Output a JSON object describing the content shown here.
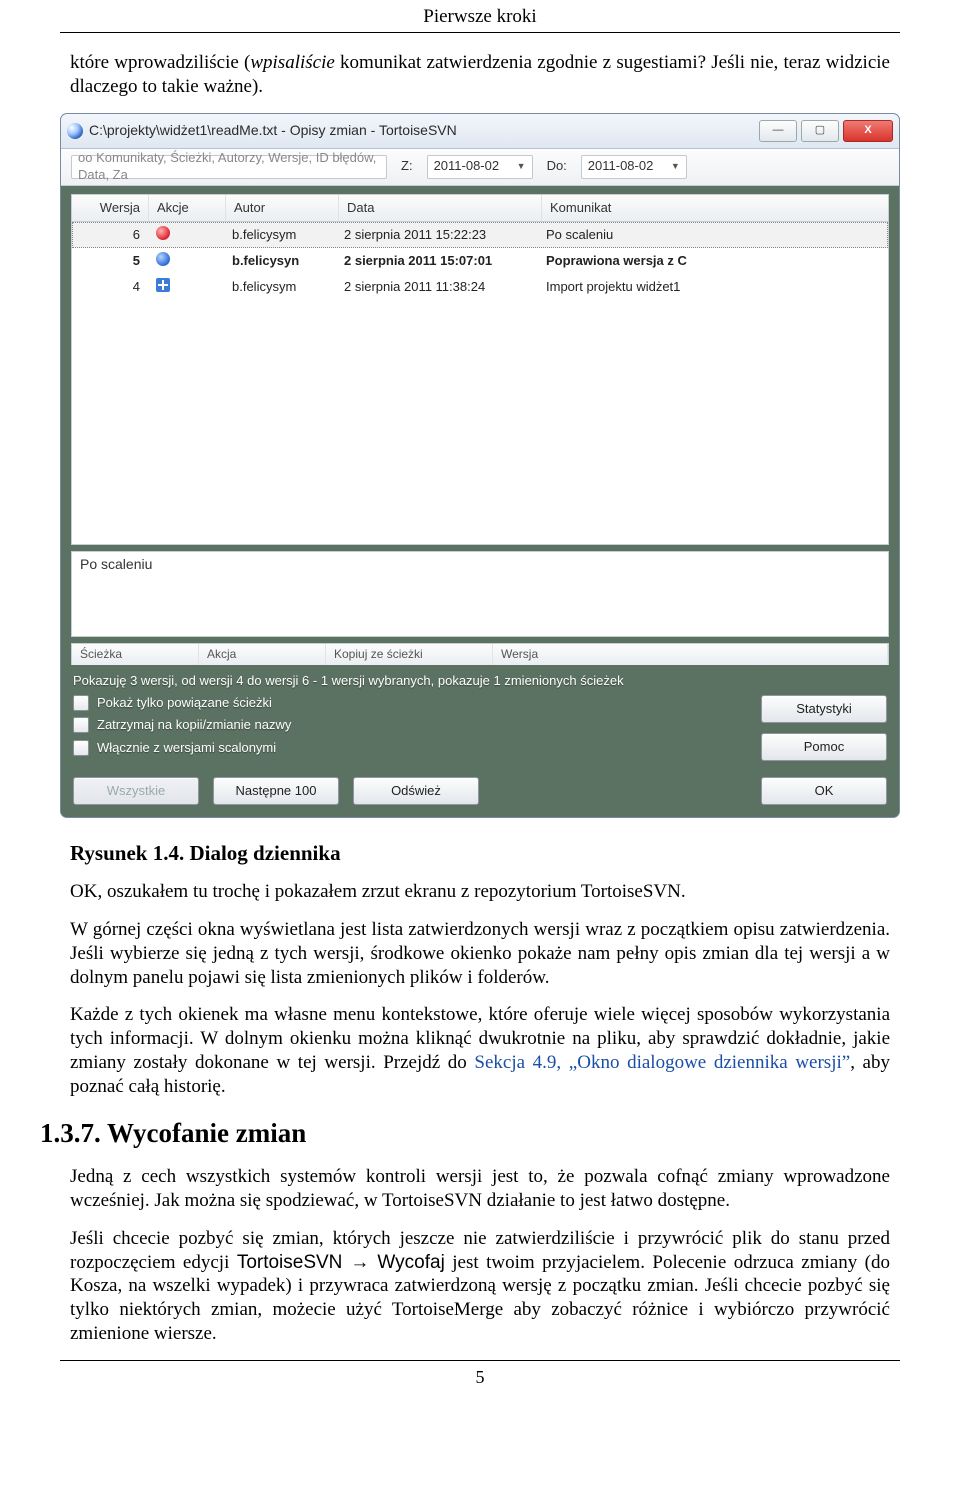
{
  "header": "Pierwsze kroki",
  "intro_before": "które wprowadziliście (",
  "intro_ital": "wpisaliście",
  "intro_after": " komunikat zatwierdzenia zgodnie z sugestiami? Jeśli nie, teraz widzicie dlaczego to takie ważne).",
  "win": {
    "title": "C:\\projekty\\widżet1\\readMe.txt - Opisy zmian - TortoiseSVN",
    "search_hint": "oo Komunikaty, Ścieżki, Autorzy, Wersje, ID błędów, Data, Za",
    "z_label": "Z:",
    "date_from": "2011-08-02",
    "do_label": "Do:",
    "date_to": "2011-08-02",
    "cols": {
      "wersja": "Wersja",
      "akcje": "Akcje",
      "autor": "Autor",
      "data": "Data",
      "komunikat": "Komunikat"
    },
    "rows": [
      {
        "w": "6",
        "icon": "red",
        "au": "b.felicysym",
        "d": "2 sierpnia 2011 15:22:23",
        "m": "Po scaleniu",
        "sel": true
      },
      {
        "w": "5",
        "icon": "blue",
        "au": "b.felicysyn",
        "d": "2 sierpnia 2011 15:07:01",
        "m": "Poprawiona wersja z C",
        "bold": true
      },
      {
        "w": "4",
        "icon": "plus",
        "au": "b.felicysym",
        "d": "2 sierpnia 2011 11:38:24",
        "m": "Import projektu widżet1"
      }
    ],
    "msg": "Po scaleniu",
    "sub": {
      "c1": "Ścieżka",
      "c2": "Akcja",
      "c3": "Kopiuj ze ścieżki",
      "c4": "Wersja"
    },
    "status": "Pokazuję 3 wersji, od wersji 4 do wersji 6 - 1 wersji wybranych, pokazuje 1 zmienionych ścieżek",
    "opts": [
      "Pokaż tylko powiązane ścieżki",
      "Zatrzymaj na kopii/zmianie nazwy",
      "Włącznie z wersjami scalonymi"
    ],
    "btn_stats": "Statystyki",
    "btn_help": "Pomoc",
    "btn_all": "Wszystkie",
    "btn_next": "Następne 100",
    "btn_refresh": "Odśwież",
    "btn_ok": "OK"
  },
  "figcap": "Rysunek 1.4. Dialog dziennika",
  "p1": "OK, oszukałem tu trochę i pokazałem zrzut ekranu z repozytorium TortoiseSVN.",
  "p2": "W górnej części okna wyświetlana jest lista zatwierdzonych wersji wraz z początkiem opisu zatwierdzenia. Jeśli wybierze się jedną z tych wersji, środkowe okienko pokaże nam pełny opis zmian dla tej wersji a w dolnym panelu pojawi się lista zmienionych plików i folderów.",
  "p3a": "Każde z tych okienek ma własne menu kontekstowe, które oferuje wiele więcej sposobów wykorzystania tych informacji. W dolnym okienku można kliknąć dwukrotnie na pliku, aby sprawdzić dokładnie, jakie zmiany zostały dokonane w tej wersji. Przejdź do ",
  "p3link": "Sekcja 4.9, „Okno dialogowe dziennika wersji”",
  "p3b": ", aby poznać całą historię.",
  "h2": "1.3.7. Wycofanie zmian",
  "p4": "Jedną z cech wszystkich systemów kontroli wersji jest to, że pozwala cofnąć zmiany wprowadzone wcześniej. Jak można się spodziewać, w TortoiseSVN działanie to jest łatwo dostępne.",
  "p5a": "Jeśli chcecie pozbyć się zmian, których jeszcze nie zatwierdziliście i przywrócić plik do stanu przed rozpoczęciem edycji ",
  "p5m1": "TortoiseSVN",
  "p5arrow": " → ",
  "p5m2": "Wycofaj",
  "p5b": " jest twoim przyjacielem. Polecenie odrzuca zmiany (do Kosza, na wszelki wypadek) i przywraca zatwierdzoną wersję z początku zmian. Jeśli chcecie pozbyć się tylko niektórych zmian, możecie użyć TortoiseMerge aby zobaczyć różnice i wybiórczo przywrócić zmienione wiersze.",
  "pagenum": "5"
}
